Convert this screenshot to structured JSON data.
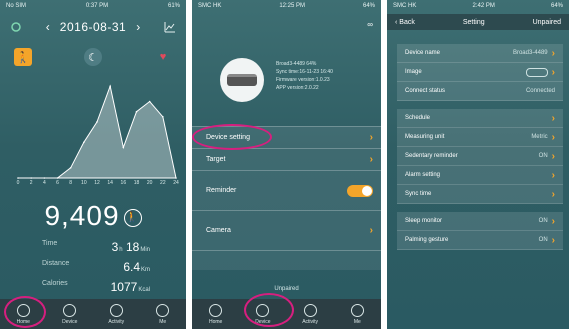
{
  "phone1": {
    "status": {
      "left": "No SIM",
      "time": "0:37 PM",
      "right": "61%"
    },
    "date": "2016-08-31",
    "chart_data": {
      "type": "area",
      "x": [
        0,
        2,
        4,
        6,
        8,
        10,
        12,
        14,
        16,
        18,
        20,
        22,
        24
      ],
      "values": [
        0,
        0,
        0,
        0,
        10,
        35,
        55,
        90,
        30,
        65,
        75,
        60,
        0
      ],
      "xlabel": "",
      "ylabel": ""
    },
    "x_ticks": [
      "0",
      "2",
      "4",
      "6",
      "8",
      "10",
      "12",
      "14",
      "16",
      "18",
      "20",
      "22",
      "24"
    ],
    "steps": "9,409",
    "stats": [
      {
        "label": "Time",
        "value": "3",
        "unit": "h",
        "value2": "18",
        "unit2": "Min"
      },
      {
        "label": "Distance",
        "value": "6.4",
        "unit": "Km",
        "value2": "",
        "unit2": ""
      },
      {
        "label": "Calories",
        "value": "1077",
        "unit": "Kcal",
        "value2": "",
        "unit2": ""
      }
    ],
    "tabs": [
      "Home",
      "Device",
      "Activity",
      "Me"
    ]
  },
  "phone2": {
    "status": {
      "left": "SMC HK",
      "time": "12:25 PM",
      "right": "64%"
    },
    "device_info": [
      "Broad3-4489  64%",
      "Sync time:16-11-23 16:40",
      "Firmware version:1.0.23",
      "APP version:2.0.22"
    ],
    "rows": [
      {
        "label": "Device setting",
        "type": "chevron"
      },
      {
        "label": "Target",
        "type": "chevron"
      },
      {
        "label": "Reminder",
        "type": "toggle"
      },
      {
        "label": "Camera",
        "type": "chevron"
      }
    ],
    "unpaired": "Unpaired",
    "tabs": [
      "Home",
      "Device",
      "Activity",
      "Me"
    ]
  },
  "phone3": {
    "status": {
      "left": "SMC HK",
      "time": "2:42 PM",
      "right": "64%"
    },
    "nav": {
      "back": "Back",
      "title": "Setting",
      "right": "Unpaired"
    },
    "groups": [
      [
        {
          "label": "Device name",
          "value": "Broad3-4489"
        },
        {
          "label": "Image",
          "value": ""
        },
        {
          "label": "Connect status",
          "value": "Connected"
        }
      ],
      [
        {
          "label": "Schedule",
          "value": ""
        },
        {
          "label": "Measuring unit",
          "value": "Metric"
        },
        {
          "label": "Sedentary reminder",
          "value": "ON"
        },
        {
          "label": "Alarm setting",
          "value": ""
        },
        {
          "label": "Sync time",
          "value": ""
        }
      ],
      [
        {
          "label": "Sleep monitor",
          "value": "ON"
        },
        {
          "label": "Palming gesture",
          "value": "ON"
        }
      ]
    ],
    "accent": "#f4a52a",
    "highlight": "#d61f7f"
  }
}
